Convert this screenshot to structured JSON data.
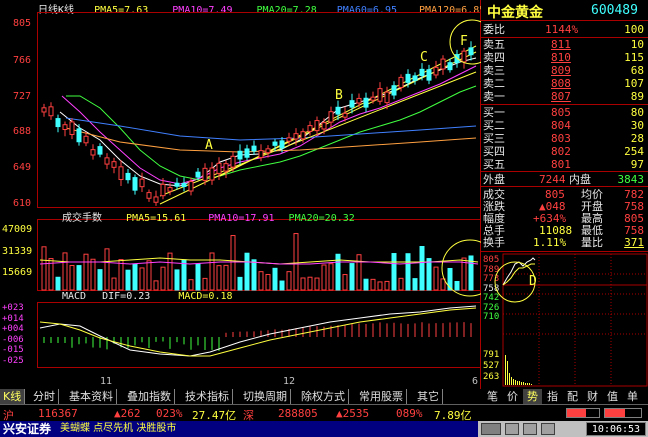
{
  "main_header": {
    "name": "日线K线",
    "pma5": "PMA5=7.63",
    "pma10": "PMA10=7.49",
    "pma20": "PMA20=7.28",
    "pma60": "PMA60=6.95",
    "pma120": "PMA120=6.85"
  },
  "price_axis": [
    "805",
    "766",
    "727",
    "688",
    "649",
    "610"
  ],
  "annotations": {
    "A": "A",
    "B": "B",
    "C": "C",
    "F": "F",
    "E": "E",
    "D": "D"
  },
  "volume_header": {
    "name": "成交手数",
    "pma5": "PMA5=15.61",
    "pma10": "PMA10=17.91",
    "pma20": "PMA20=20.32"
  },
  "volume_axis": [
    "47009",
    "31339",
    "15669"
  ],
  "macd_header": {
    "name": "MACD",
    "dif": "DIF=0.23",
    "macd": "MACD=0.18"
  },
  "macd_axis": [
    "+023",
    "+014",
    "+004",
    "-006",
    "-015",
    "-025"
  ],
  "date_axis": [
    "11",
    "12",
    "6"
  ],
  "stock": {
    "name": "中金黄金",
    "code": "600489"
  },
  "order_book": {
    "weibi": {
      "label": "委比",
      "value": "1144%",
      "vol": "100"
    },
    "asks": [
      {
        "label": "卖五",
        "price": "811",
        "vol": "10"
      },
      {
        "label": "卖四",
        "price": "810",
        "vol": "115"
      },
      {
        "label": "卖三",
        "price": "809",
        "vol": "68"
      },
      {
        "label": "卖二",
        "price": "808",
        "vol": "107"
      },
      {
        "label": "卖一",
        "price": "807",
        "vol": "89"
      }
    ],
    "bids": [
      {
        "label": "买一",
        "price": "805",
        "vol": "80"
      },
      {
        "label": "买二",
        "price": "804",
        "vol": "30"
      },
      {
        "label": "买三",
        "price": "803",
        "vol": "28"
      },
      {
        "label": "买四",
        "price": "802",
        "vol": "254"
      },
      {
        "label": "买五",
        "price": "801",
        "vol": "97"
      }
    ]
  },
  "trade_info": {
    "waipan_label": "外盘",
    "waipan": "7244",
    "neipan_label": "内盘",
    "neipan": "3843",
    "chengjiao_label": "成交",
    "chengjiao": "805",
    "junjia_label": "均价",
    "junjia": "782",
    "zhangdie_label": "涨跌",
    "zhangdie": "▲048",
    "kaipan_label": "开盘",
    "kaipan": "758",
    "fudu_label": "幅度",
    "fudu": "+634%",
    "zuigao_label": "最高",
    "zuigao": "805",
    "zongshou_label": "总手",
    "zongshou": "11088",
    "zuidi_label": "最低",
    "zuidi": "758",
    "huanshou_label": "换手",
    "huanshou": "1.11%",
    "liangbi_label": "量比",
    "liangbi": "371"
  },
  "mini_axis": [
    "805",
    "789",
    "773",
    "758",
    "742",
    "726",
    "710",
    "791",
    "527",
    "263"
  ],
  "right_tabs": [
    "笔",
    "价",
    "势",
    "指",
    "配",
    "财",
    "值",
    "单"
  ],
  "tabs": [
    "K线",
    "分时",
    "基本资料",
    "叠加指数",
    "技术指标",
    "切换周期",
    "除权方式",
    "常用股票",
    "其它"
  ],
  "status": {
    "sh_label": "沪",
    "sh_index": "116367",
    "sh_change": "▲262",
    "sh_pct": "023%",
    "sh_amount": "27.47亿",
    "sz_label": "深",
    "sz_index": "288805",
    "sz_change": "▲2535",
    "sz_pct": "089%",
    "sz_amount": "7.89亿"
  },
  "bottom": {
    "broker": "兴安证券",
    "ticker_text": "美蝴蝶 点尽先机 决胜股市",
    "time": "10:06:53"
  },
  "colors": {
    "up": "#ff4040",
    "down": "#40ffff",
    "ma5": "#ffffff",
    "ma10": "#ff40ff",
    "ma20": "#40ff40",
    "ma60": "#4080ff",
    "ma120": "#ffa040"
  }
}
